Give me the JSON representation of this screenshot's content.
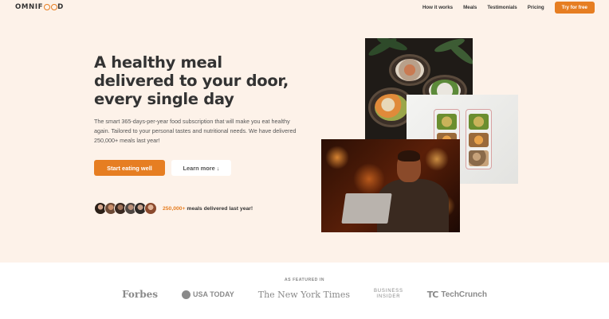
{
  "header": {
    "logo_before": "OMNIF",
    "logo_after": "D",
    "nav": [
      {
        "label": "How it works"
      },
      {
        "label": "Meals"
      },
      {
        "label": "Testimonials"
      },
      {
        "label": "Pricing"
      }
    ],
    "cta_label": "Try for free"
  },
  "hero": {
    "headline": "A healthy meal delivered to your door, every single day",
    "description": "The smart 365-days-per-year food subscription that will make you eat healthy again. Tailored to your personal tastes and nutritional needs. We have delivered 250,000+ meals last year!",
    "primary_button": "Start eating well",
    "secondary_button": "Learn more ↓",
    "delivered_highlight": "250,000+",
    "delivered_text": " meals delivered last year!"
  },
  "featured": {
    "label": "AS FEATURED IN",
    "logos": {
      "forbes": "Forbes",
      "usatoday": "USA TODAY",
      "nyt": "The New York Times",
      "bi_line1": "BUSINESS",
      "bi_line2": "INSIDER",
      "tc_mark": "TC",
      "techcrunch": "TechCrunch"
    }
  },
  "colors": {
    "accent": "#e67e22",
    "hero_background": "#fdf2e9",
    "text": "#333333"
  }
}
